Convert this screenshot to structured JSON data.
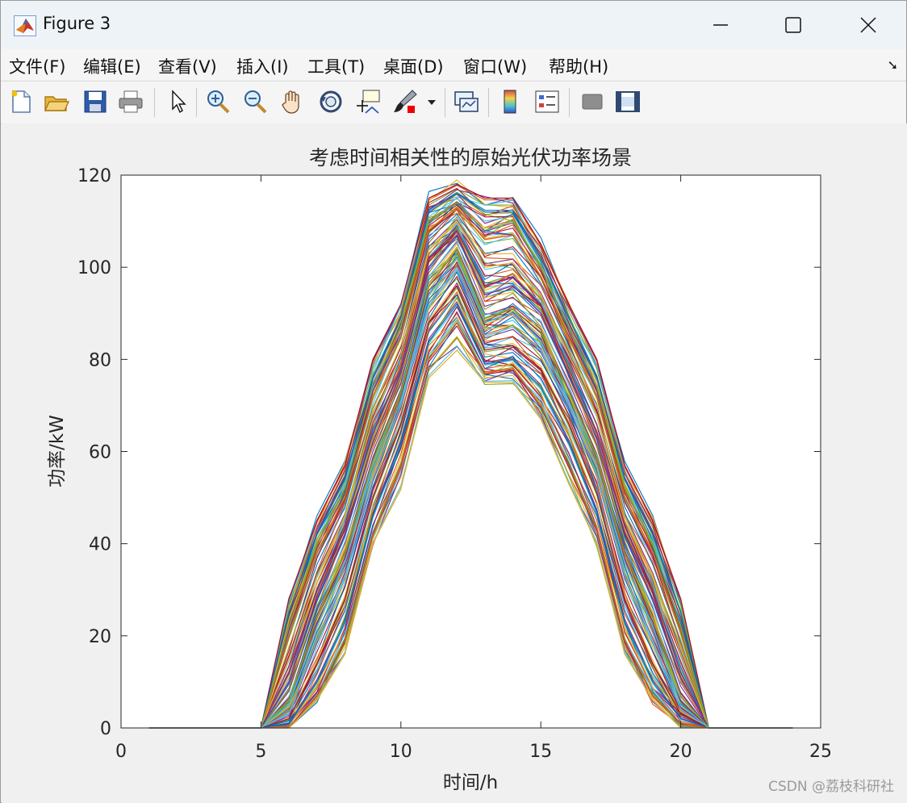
{
  "window": {
    "title": "Figure 3",
    "icon": "matlab-icon",
    "controls": [
      "minimize-icon",
      "maximize-icon",
      "close-icon"
    ]
  },
  "menu": [
    {
      "label": "文件(F)"
    },
    {
      "label": "编辑(E)"
    },
    {
      "label": "查看(V)"
    },
    {
      "label": "插入(I)"
    },
    {
      "label": "工具(T)"
    },
    {
      "label": "桌面(D)"
    },
    {
      "label": "窗口(W)"
    },
    {
      "label": "帮助(H)"
    }
  ],
  "toolbar": {
    "icons": [
      "new-figure-icon",
      "open-file-icon",
      "save-icon",
      "print-icon",
      "select-arrow-icon",
      "zoom-in-icon",
      "zoom-out-icon",
      "pan-hand-icon",
      "rotate-3d-icon",
      "data-cursor-icon",
      "brush-icon",
      "brush-dropdown-icon",
      "link-plot-icon",
      "colorbar-icon",
      "legend-icon",
      "hide-plot-tools-icon",
      "show-plot-tools-icon"
    ]
  },
  "watermark": "CSDN @荔枝科研社",
  "chart_data": {
    "type": "line",
    "title": "考虑时间相关性的原始光伏功率场景",
    "xlabel": "时间/h",
    "ylabel": "功率/kW",
    "xlim": [
      0,
      25
    ],
    "ylim": [
      0,
      120
    ],
    "xticks": [
      0,
      5,
      10,
      15,
      20,
      25
    ],
    "yticks": [
      0,
      20,
      40,
      60,
      80,
      100,
      120
    ],
    "grid": false,
    "legend": "none",
    "colors": [
      "#0072BD",
      "#D95319",
      "#EDB120",
      "#7E2F8E",
      "#77AC30",
      "#4DBEEE",
      "#A2142F"
    ],
    "x": [
      1,
      2,
      3,
      4,
      5,
      6,
      7,
      8,
      9,
      10,
      11,
      12,
      13,
      14,
      15,
      16,
      17,
      18,
      19,
      20,
      21,
      22,
      23,
      24
    ],
    "series": [
      {
        "values": [
          0,
          0,
          0,
          0,
          0,
          28,
          45,
          57,
          80,
          92,
          115,
          118,
          115,
          115,
          105,
          92,
          80,
          57,
          45,
          28,
          0,
          0,
          0,
          0
        ]
      },
      {
        "values": [
          0,
          0,
          0,
          0,
          0,
          25,
          42,
          54,
          76,
          89,
          112,
          116,
          112,
          112,
          102,
          89,
          76,
          54,
          42,
          25,
          0,
          0,
          0,
          0
        ]
      },
      {
        "values": [
          0,
          0,
          0,
          0,
          0,
          20,
          38,
          50,
          72,
          85,
          108,
          113,
          106,
          107,
          98,
          85,
          72,
          50,
          38,
          21,
          0,
          0,
          0,
          0
        ]
      },
      {
        "values": [
          0,
          0,
          0,
          0,
          0,
          15,
          33,
          46,
          67,
          81,
          104,
          110,
          100,
          101,
          94,
          81,
          68,
          46,
          33,
          16,
          0,
          0,
          0,
          0
        ]
      },
      {
        "values": [
          0,
          0,
          0,
          0,
          0,
          10,
          28,
          42,
          62,
          77,
          100,
          107,
          94,
          96,
          90,
          77,
          63,
          42,
          28,
          11,
          0,
          0,
          0,
          0
        ]
      },
      {
        "values": [
          0,
          0,
          0,
          0,
          0,
          6,
          24,
          38,
          58,
          73,
          96,
          104,
          89,
          91,
          86,
          73,
          59,
          38,
          24,
          7,
          0,
          0,
          0,
          0
        ]
      },
      {
        "values": [
          0,
          0,
          0,
          0,
          0,
          3,
          19,
          33,
          54,
          70,
          92,
          100,
          85,
          87,
          82,
          70,
          55,
          33,
          19,
          4,
          0,
          0,
          0,
          0
        ]
      },
      {
        "values": [
          0,
          0,
          0,
          0,
          0,
          2,
          14,
          28,
          50,
          66,
          88,
          96,
          82,
          83,
          78,
          66,
          51,
          28,
          14,
          3,
          0,
          0,
          0,
          0
        ]
      },
      {
        "values": [
          0,
          0,
          0,
          0,
          0,
          1,
          10,
          23,
          46,
          62,
          84,
          92,
          79,
          80,
          74,
          62,
          47,
          23,
          10,
          2,
          0,
          0,
          0,
          0
        ]
      },
      {
        "values": [
          0,
          0,
          0,
          0,
          0,
          0,
          7,
          19,
          42,
          57,
          80,
          88,
          77,
          78,
          70,
          57,
          43,
          19,
          7,
          1,
          0,
          0,
          0,
          0
        ]
      },
      {
        "values": [
          0,
          0,
          0,
          0,
          0,
          0,
          6,
          16,
          40,
          52,
          76,
          82,
          75,
          75,
          67,
          53,
          40,
          16,
          6,
          0,
          0,
          0,
          0,
          0
        ]
      },
      {
        "values": [
          0,
          0,
          0,
          0,
          0,
          12,
          30,
          44,
          64,
          78,
          102,
          108,
          96,
          98,
          92,
          78,
          64,
          44,
          30,
          12,
          0,
          0,
          0,
          0
        ]
      },
      {
        "values": [
          0,
          0,
          0,
          0,
          0,
          22,
          40,
          52,
          74,
          87,
          110,
          114,
          108,
          110,
          100,
          87,
          74,
          52,
          40,
          22,
          0,
          0,
          0,
          0
        ]
      },
      {
        "values": [
          0,
          0,
          0,
          0,
          0,
          5,
          22,
          36,
          56,
          71,
          94,
          102,
          88,
          90,
          84,
          71,
          57,
          36,
          22,
          5,
          0,
          0,
          0,
          0
        ]
      }
    ]
  }
}
